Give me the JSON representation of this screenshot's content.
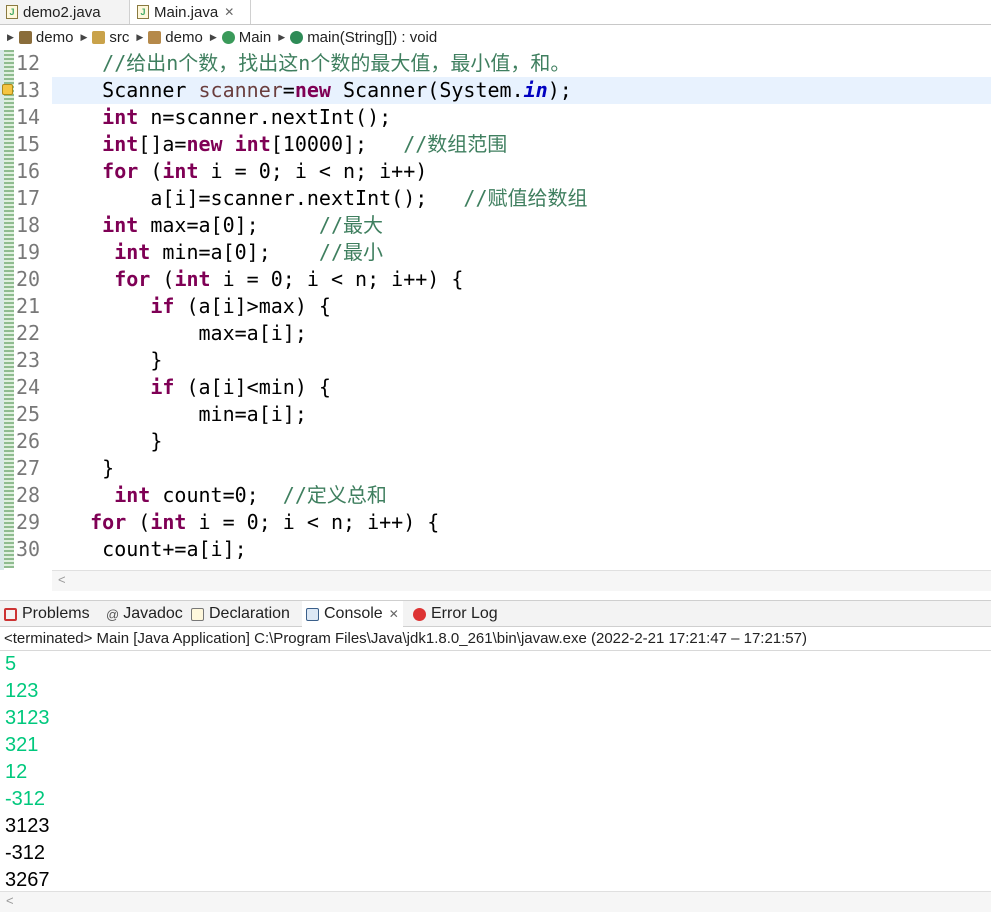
{
  "editor_tabs": [
    {
      "label": "demo2.java"
    },
    {
      "label": "Main.java",
      "close": "✕"
    }
  ],
  "breadcrumb": [
    "demo",
    "src",
    "demo",
    "Main",
    "main(String[]) : void"
  ],
  "code": {
    "current_line": 13,
    "lines": [
      {
        "n": "12",
        "tokens": [
          [
            "    ",
            ""
          ],
          [
            "//给出n个数，找出这n个数的最大值，最小值，和。",
            "cm"
          ]
        ]
      },
      {
        "n": "13",
        "tokens": [
          [
            "    Scanner ",
            ""
          ],
          [
            "scanner",
            "var"
          ],
          [
            "=",
            ""
          ],
          [
            "new",
            "kw"
          ],
          [
            " Scanner(System.",
            ""
          ],
          [
            "in",
            "fld"
          ],
          [
            ");",
            ""
          ]
        ]
      },
      {
        "n": "14",
        "tokens": [
          [
            "    ",
            ""
          ],
          [
            "int",
            "kw"
          ],
          [
            " n=scanner.nextInt();",
            ""
          ]
        ]
      },
      {
        "n": "15",
        "tokens": [
          [
            "    ",
            ""
          ],
          [
            "int",
            "kw"
          ],
          [
            "[]a=",
            ""
          ],
          [
            "new",
            "kw"
          ],
          [
            " ",
            ""
          ],
          [
            "int",
            "kw"
          ],
          [
            "[10000];   ",
            ""
          ],
          [
            "//数组范围",
            "cm"
          ]
        ]
      },
      {
        "n": "16",
        "tokens": [
          [
            "    ",
            ""
          ],
          [
            "for",
            "kw"
          ],
          [
            " (",
            ""
          ],
          [
            "int",
            "kw"
          ],
          [
            " i = 0; i < n; i++)",
            ""
          ]
        ]
      },
      {
        "n": "17",
        "tokens": [
          [
            "        a[i]=scanner.nextInt();   ",
            ""
          ],
          [
            "//赋值给数组",
            "cm"
          ]
        ]
      },
      {
        "n": "18",
        "tokens": [
          [
            "    ",
            ""
          ],
          [
            "int",
            "kw"
          ],
          [
            " max=a[0];     ",
            ""
          ],
          [
            "//最大",
            "cm"
          ]
        ]
      },
      {
        "n": "19",
        "tokens": [
          [
            "     ",
            ""
          ],
          [
            "int",
            "kw"
          ],
          [
            " min=a[0];    ",
            ""
          ],
          [
            "//最小",
            "cm"
          ]
        ]
      },
      {
        "n": "20",
        "tokens": [
          [
            "     ",
            ""
          ],
          [
            "for",
            "kw"
          ],
          [
            " (",
            ""
          ],
          [
            "int",
            "kw"
          ],
          [
            " i = 0; i < n; i++) {",
            ""
          ]
        ]
      },
      {
        "n": "21",
        "tokens": [
          [
            "        ",
            ""
          ],
          [
            "if",
            "kw"
          ],
          [
            " (a[i]>max) {",
            ""
          ]
        ]
      },
      {
        "n": "22",
        "tokens": [
          [
            "            max=a[i];",
            ""
          ]
        ]
      },
      {
        "n": "23",
        "tokens": [
          [
            "        }",
            ""
          ]
        ]
      },
      {
        "n": "24",
        "tokens": [
          [
            "        ",
            ""
          ],
          [
            "if",
            "kw"
          ],
          [
            " (a[i]<min) {",
            ""
          ]
        ]
      },
      {
        "n": "25",
        "tokens": [
          [
            "            min=a[i];",
            ""
          ]
        ]
      },
      {
        "n": "26",
        "tokens": [
          [
            "        }",
            ""
          ]
        ]
      },
      {
        "n": "27",
        "tokens": [
          [
            "    }",
            ""
          ]
        ]
      },
      {
        "n": "28",
        "tokens": [
          [
            "     ",
            ""
          ],
          [
            "int",
            "kw"
          ],
          [
            " count=0;  ",
            ""
          ],
          [
            "//定义总和",
            "cm"
          ]
        ]
      },
      {
        "n": "29",
        "tokens": [
          [
            "   ",
            ""
          ],
          [
            "for",
            "kw"
          ],
          [
            " (",
            ""
          ],
          [
            "int",
            "kw"
          ],
          [
            " i = 0; i < n; i++) {",
            ""
          ]
        ]
      },
      {
        "n": "30",
        "tokens": [
          [
            "    count+=a[i];",
            ""
          ]
        ]
      }
    ]
  },
  "console_tabs": [
    {
      "label": "Problems",
      "icon": "problems-icon"
    },
    {
      "label": "Javadoc",
      "icon": "at-icon"
    },
    {
      "label": "Declaration",
      "icon": "declaration-icon"
    },
    {
      "label": "Console",
      "icon": "console-icon",
      "close": "✕"
    },
    {
      "label": "Error Log",
      "icon": "error-log-icon"
    }
  ],
  "console_status": "<terminated> Main [Java Application] C:\\Program Files\\Java\\jdk1.8.0_261\\bin\\javaw.exe  (2022-2-21 17:21:47 – 17:21:57)",
  "console_output": [
    {
      "text": "5",
      "kind": "in"
    },
    {
      "text": "123",
      "kind": "in"
    },
    {
      "text": "3123",
      "kind": "in"
    },
    {
      "text": "321",
      "kind": "in"
    },
    {
      "text": "12",
      "kind": "in"
    },
    {
      "text": "-312",
      "kind": "in"
    },
    {
      "text": "3123",
      "kind": "out"
    },
    {
      "text": "-312",
      "kind": "out"
    },
    {
      "text": "3267",
      "kind": "out"
    }
  ],
  "colors": {
    "input_text": "#00c87d",
    "keyword": "#7f0055",
    "comment": "#3f7f5f",
    "current_line": "#e8f2fe"
  }
}
